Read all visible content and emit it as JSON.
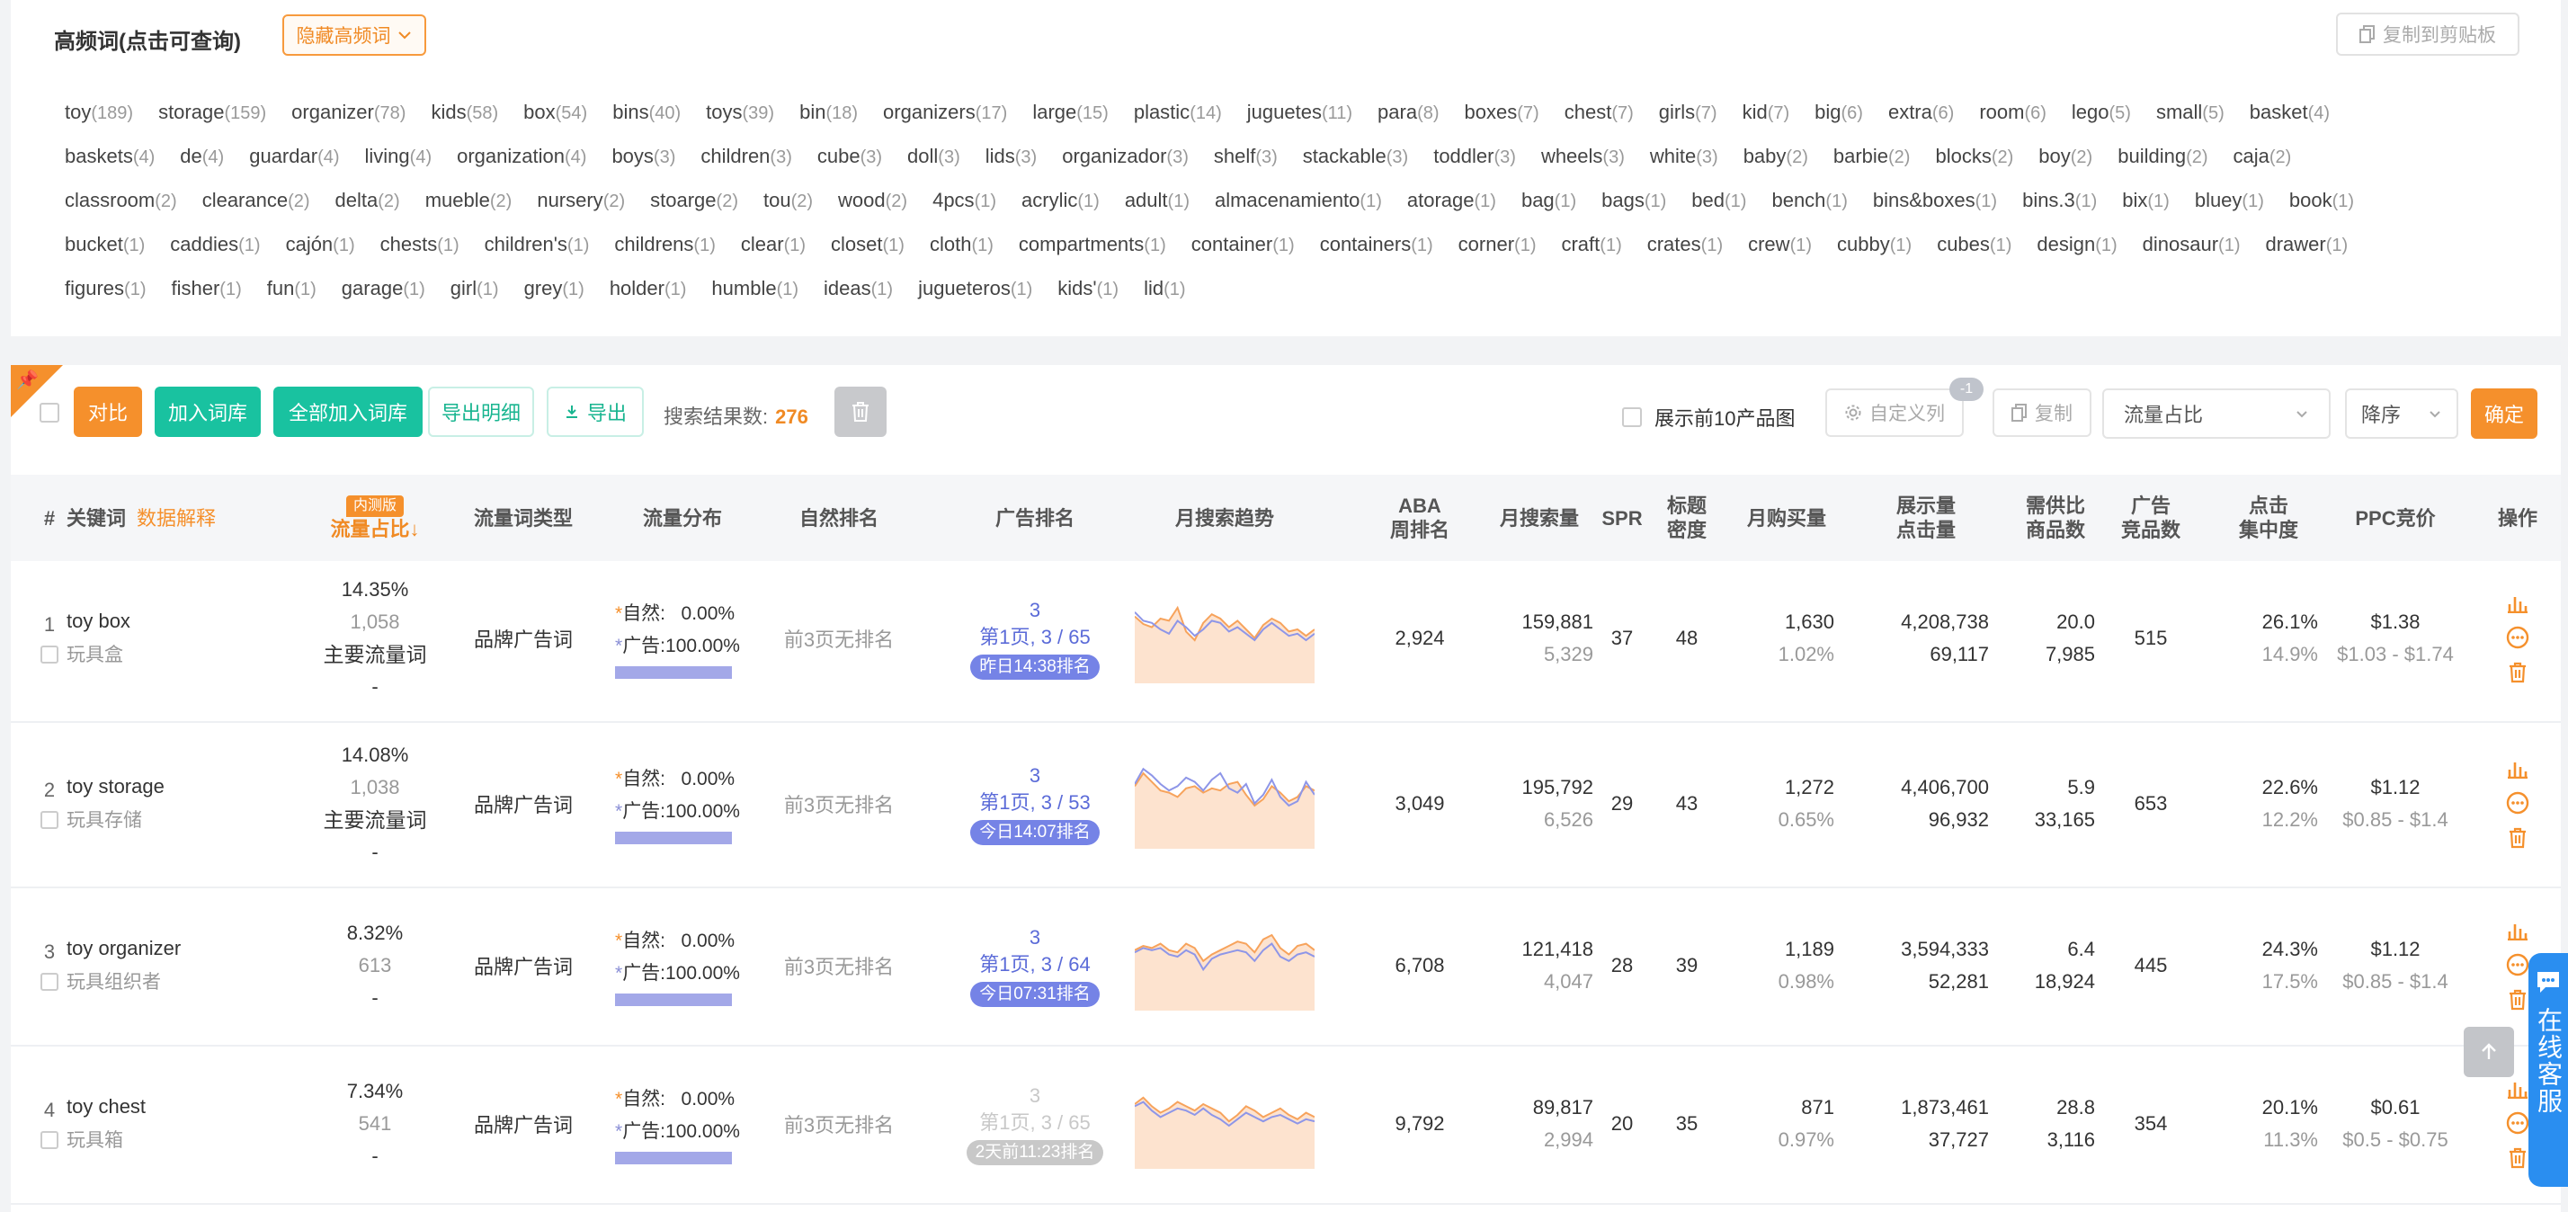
{
  "hf": {
    "title": "高频词(点击可查询)",
    "hide_label": "隐藏高频词",
    "copy_label": "复制到剪贴板",
    "rows": [
      [
        [
          "toy",
          "(189)"
        ],
        [
          "storage",
          "(159)"
        ],
        [
          "organizer",
          "(78)"
        ],
        [
          "kids",
          "(58)"
        ],
        [
          "box",
          "(54)"
        ],
        [
          "bins",
          "(40)"
        ],
        [
          "toys",
          "(39)"
        ],
        [
          "bin",
          "(18)"
        ],
        [
          "organizers",
          "(17)"
        ],
        [
          "large",
          "(15)"
        ],
        [
          "plastic",
          "(14)"
        ],
        [
          "juguetes",
          "(11)"
        ],
        [
          "para",
          "(8)"
        ],
        [
          "boxes",
          "(7)"
        ],
        [
          "chest",
          "(7)"
        ],
        [
          "girls",
          "(7)"
        ],
        [
          "kid",
          "(7)"
        ],
        [
          "big",
          "(6)"
        ],
        [
          "extra",
          "(6)"
        ],
        [
          "room",
          "(6)"
        ],
        [
          "lego",
          "(5)"
        ],
        [
          "small",
          "(5)"
        ],
        [
          "basket",
          "(4)"
        ]
      ],
      [
        [
          "baskets",
          "(4)"
        ],
        [
          "de",
          "(4)"
        ],
        [
          "guardar",
          "(4)"
        ],
        [
          "living",
          "(4)"
        ],
        [
          "organization",
          "(4)"
        ],
        [
          "boys",
          "(3)"
        ],
        [
          "children",
          "(3)"
        ],
        [
          "cube",
          "(3)"
        ],
        [
          "doll",
          "(3)"
        ],
        [
          "lids",
          "(3)"
        ],
        [
          "organizador",
          "(3)"
        ],
        [
          "shelf",
          "(3)"
        ],
        [
          "stackable",
          "(3)"
        ],
        [
          "toddler",
          "(3)"
        ],
        [
          "wheels",
          "(3)"
        ],
        [
          "white",
          "(3)"
        ],
        [
          "baby",
          "(2)"
        ],
        [
          "barbie",
          "(2)"
        ],
        [
          "blocks",
          "(2)"
        ],
        [
          "boy",
          "(2)"
        ],
        [
          "building",
          "(2)"
        ],
        [
          "caja",
          "(2)"
        ]
      ],
      [
        [
          "classroom",
          "(2)"
        ],
        [
          "clearance",
          "(2)"
        ],
        [
          "delta",
          "(2)"
        ],
        [
          "mueble",
          "(2)"
        ],
        [
          "nursery",
          "(2)"
        ],
        [
          "stoarge",
          "(2)"
        ],
        [
          "tou",
          "(2)"
        ],
        [
          "wood",
          "(2)"
        ],
        [
          "4pcs",
          "(1)"
        ],
        [
          "acrylic",
          "(1)"
        ],
        [
          "adult",
          "(1)"
        ],
        [
          "almacenamiento",
          "(1)"
        ],
        [
          "atorage",
          "(1)"
        ],
        [
          "bag",
          "(1)"
        ],
        [
          "bags",
          "(1)"
        ],
        [
          "bed",
          "(1)"
        ],
        [
          "bench",
          "(1)"
        ],
        [
          "bins&boxes",
          "(1)"
        ],
        [
          "bins.3",
          "(1)"
        ],
        [
          "bix",
          "(1)"
        ],
        [
          "bluey",
          "(1)"
        ],
        [
          "book",
          "(1)"
        ]
      ],
      [
        [
          "bucket",
          "(1)"
        ],
        [
          "caddies",
          "(1)"
        ],
        [
          "cajón",
          "(1)"
        ],
        [
          "chests",
          "(1)"
        ],
        [
          "children's",
          "(1)"
        ],
        [
          "childrens",
          "(1)"
        ],
        [
          "clear",
          "(1)"
        ],
        [
          "closet",
          "(1)"
        ],
        [
          "cloth",
          "(1)"
        ],
        [
          "compartments",
          "(1)"
        ],
        [
          "container",
          "(1)"
        ],
        [
          "containers",
          "(1)"
        ],
        [
          "corner",
          "(1)"
        ],
        [
          "craft",
          "(1)"
        ],
        [
          "crates",
          "(1)"
        ],
        [
          "crew",
          "(1)"
        ],
        [
          "cubby",
          "(1)"
        ],
        [
          "cubes",
          "(1)"
        ],
        [
          "design",
          "(1)"
        ],
        [
          "dinosaur",
          "(1)"
        ],
        [
          "drawer",
          "(1)"
        ]
      ],
      [
        [
          "figures",
          "(1)"
        ],
        [
          "fisher",
          "(1)"
        ],
        [
          "fun",
          "(1)"
        ],
        [
          "garage",
          "(1)"
        ],
        [
          "girl",
          "(1)"
        ],
        [
          "grey",
          "(1)"
        ],
        [
          "holder",
          "(1)"
        ],
        [
          "humble",
          "(1)"
        ],
        [
          "ideas",
          "(1)"
        ],
        [
          "jugueteros",
          "(1)"
        ],
        [
          "kids'",
          "(1)"
        ],
        [
          "lid",
          "(1)"
        ]
      ]
    ]
  },
  "toolbar": {
    "compare": "对比",
    "add_lib": "加入词库",
    "add_all": "全部加入词库",
    "export_detail": "导出明细",
    "export": "导出",
    "result_label": "搜索结果数:",
    "result_count": "276",
    "top10": "展示前10产品图",
    "custom_col": "自定义列",
    "custom_badge": "-1",
    "copy": "复制",
    "sort_field": "流量占比",
    "sort_order": "降序",
    "confirm": "确定"
  },
  "headers": {
    "idx": "#",
    "keyword": "关键词",
    "explain": "数据解释",
    "beta": "内测版",
    "flow": "流量占比↓",
    "type": "流量词类型",
    "dist": "流量分布",
    "organic": "自然排名",
    "ad": "广告排名",
    "trend": "月搜索趋势",
    "aba_1": "ABA",
    "aba_2": "周排名",
    "mvol": "月搜索量",
    "spr": "SPR",
    "dens_1": "标题",
    "dens_2": "密度",
    "mbuy": "月购买量",
    "disp_1": "展示量",
    "disp_2": "点击量",
    "ratio_1": "需供比",
    "ratio_2": "商品数",
    "adcomp_1": "广告",
    "adcomp_2": "竞品数",
    "click_1": "点击",
    "click_2": "集中度",
    "ppc": "PPC竞价",
    "ops": "操作"
  },
  "rows": [
    {
      "idx": "1",
      "en": "toy box",
      "zh": "玩具盒",
      "pct": "14.35%",
      "n": "1,058",
      "main": "主要流量词",
      "dash": "-",
      "type": "品牌广告词",
      "organic_label": "自然:",
      "organic_val": "0.00%",
      "ad_label": "广告:",
      "ad_val": "100.00%",
      "organic_rank": "前3页无排名",
      "ad_top": "3",
      "ad_pg": "第1页, 3 / 65",
      "ad_time": "昨日14:38排名",
      "faded": false,
      "aba": "2,924",
      "mvol": "159,881",
      "mvol_s": "5,329",
      "spr": "37",
      "dens": "48",
      "mbuy": "1,630",
      "mbuy_s": "1.02%",
      "disp": "4,208,738",
      "disp_s": "69,117",
      "ratio": "20.0",
      "ratio_s": "7,985",
      "adcomp": "515",
      "click": "26.1%",
      "click_s": "14.9%",
      "ppc": "$1.38",
      "ppc_s": "$1.03 - $1.74",
      "trend_a": [
        62,
        55,
        52,
        60,
        58,
        70,
        48,
        40,
        56,
        64,
        60,
        52,
        58,
        50,
        42,
        54,
        60,
        56,
        48,
        50,
        44,
        50
      ],
      "trend_b": [
        66,
        58,
        56,
        50,
        46,
        58,
        52,
        44,
        50,
        58,
        56,
        48,
        52,
        46,
        40,
        50,
        56,
        50,
        44,
        46,
        40,
        46
      ]
    },
    {
      "idx": "2",
      "en": "toy storage",
      "zh": "玩具存储",
      "pct": "14.08%",
      "n": "1,038",
      "main": "主要流量词",
      "dash": "-",
      "type": "品牌广告词",
      "organic_label": "自然:",
      "organic_val": "0.00%",
      "ad_label": "广告:",
      "ad_val": "100.00%",
      "organic_rank": "前3页无排名",
      "ad_top": "3",
      "ad_pg": "第1页, 3 / 53",
      "ad_time": "今日14:07排名",
      "faded": false,
      "aba": "3,049",
      "mvol": "195,792",
      "mvol_s": "6,526",
      "spr": "29",
      "dens": "43",
      "mbuy": "1,272",
      "mbuy_s": "0.65%",
      "disp": "4,406,700",
      "disp_s": "96,932",
      "ratio": "5.9",
      "ratio_s": "33,165",
      "adcomp": "653",
      "click": "22.6%",
      "click_s": "12.2%",
      "ppc": "$1.12",
      "ppc_s": "$0.85 - $1.4",
      "trend_a": [
        58,
        70,
        62,
        54,
        52,
        48,
        56,
        58,
        52,
        56,
        54,
        60,
        62,
        50,
        40,
        46,
        58,
        52,
        44,
        48,
        58,
        54
      ],
      "trend_b": [
        60,
        74,
        68,
        60,
        54,
        58,
        66,
        62,
        54,
        64,
        70,
        56,
        52,
        60,
        42,
        50,
        64,
        48,
        40,
        44,
        62,
        50
      ]
    },
    {
      "idx": "3",
      "en": "toy organizer",
      "zh": "玩具组织者",
      "pct": "8.32%",
      "n": "613",
      "main": "",
      "dash": "-",
      "type": "品牌广告词",
      "organic_label": "自然:",
      "organic_val": "0.00%",
      "ad_label": "广告:",
      "ad_val": "100.00%",
      "organic_rank": "前3页无排名",
      "ad_top": "3",
      "ad_pg": "第1页, 3 / 64",
      "ad_time": "今日07:31排名",
      "faded": false,
      "aba": "6,708",
      "mvol": "121,418",
      "mvol_s": "4,047",
      "spr": "28",
      "dens": "39",
      "mbuy": "1,189",
      "mbuy_s": "0.98%",
      "disp": "3,594,333",
      "disp_s": "52,281",
      "ratio": "6.4",
      "ratio_s": "18,924",
      "adcomp": "445",
      "click": "24.3%",
      "click_s": "17.5%",
      "ppc": "$1.12",
      "ppc_s": "$0.85 - $1.4",
      "trend_a": [
        56,
        60,
        58,
        62,
        56,
        54,
        62,
        58,
        46,
        52,
        56,
        60,
        64,
        62,
        54,
        66,
        70,
        58,
        52,
        60,
        62,
        56
      ],
      "trend_b": [
        54,
        58,
        56,
        58,
        52,
        50,
        56,
        52,
        38,
        48,
        52,
        54,
        56,
        54,
        46,
        56,
        62,
        50,
        46,
        52,
        54,
        50
      ]
    },
    {
      "idx": "4",
      "en": "toy chest",
      "zh": "玩具箱",
      "pct": "7.34%",
      "n": "541",
      "main": "",
      "dash": "-",
      "type": "品牌广告词",
      "organic_label": "自然:",
      "organic_val": "0.00%",
      "ad_label": "广告:",
      "ad_val": "100.00%",
      "organic_rank": "前3页无排名",
      "ad_top": "3",
      "ad_pg": "第1页, 3 / 65",
      "ad_time": "2天前11:23排名",
      "faded": true,
      "aba": "9,792",
      "mvol": "89,817",
      "mvol_s": "2,994",
      "spr": "20",
      "dens": "35",
      "mbuy": "871",
      "mbuy_s": "0.97%",
      "disp": "1,873,461",
      "disp_s": "37,727",
      "ratio": "28.8",
      "ratio_s": "3,116",
      "adcomp": "354",
      "click": "20.1%",
      "click_s": "11.3%",
      "ppc": "$0.61",
      "ppc_s": "$0.5 - $0.75",
      "trend_a": [
        60,
        66,
        58,
        52,
        56,
        62,
        58,
        54,
        60,
        56,
        52,
        44,
        50,
        58,
        54,
        48,
        52,
        56,
        50,
        46,
        52,
        48
      ],
      "trend_b": [
        58,
        62,
        54,
        48,
        52,
        56,
        54,
        50,
        56,
        50,
        46,
        40,
        46,
        52,
        48,
        44,
        48,
        50,
        46,
        42,
        46,
        44
      ]
    }
  ],
  "float": {
    "service": "在线客服"
  }
}
